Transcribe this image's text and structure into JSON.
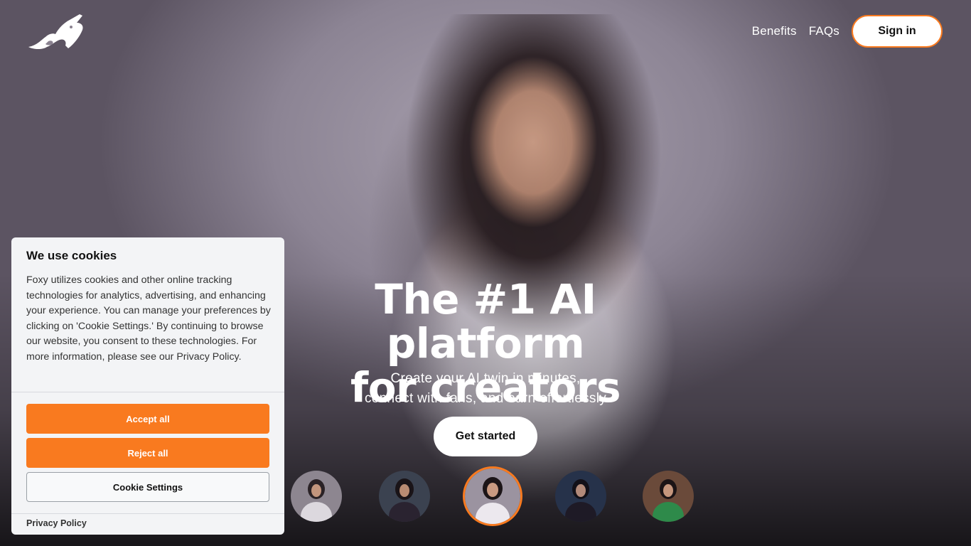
{
  "brand": {
    "logo_icon": "fox-logo-icon",
    "accent_color": "#f97a1f"
  },
  "nav": {
    "links": [
      "Benefits",
      "FAQs"
    ],
    "signin_label": "Sign in"
  },
  "hero": {
    "headline_line1": "The #1 AI platform",
    "headline_line2": "for creators",
    "sub_line1": "Create your AI twin in minutes,",
    "sub_line2": "connect with fans, and earn effortlessly",
    "cta_label": "Get started"
  },
  "creators": {
    "thumbnail_count": 5,
    "selected_index": 2,
    "outfit_colors": [
      "#d9d6dc",
      "#2a2330",
      "#e9e5ea",
      "#1e1a26",
      "#2e8a4a"
    ]
  },
  "cookie_banner": {
    "title": "We use cookies",
    "body": "Foxy utilizes cookies and other online tracking technologies for analytics, advertising, and enhancing your experience. You can manage your preferences by clicking on 'Cookie Settings.' By continuing to browse our website, you consent to these technologies. For more information, please see our Privacy Policy.",
    "accept_label": "Accept all",
    "reject_label": "Reject all",
    "settings_label": "Cookie Settings",
    "privacy_link": "Privacy Policy"
  }
}
